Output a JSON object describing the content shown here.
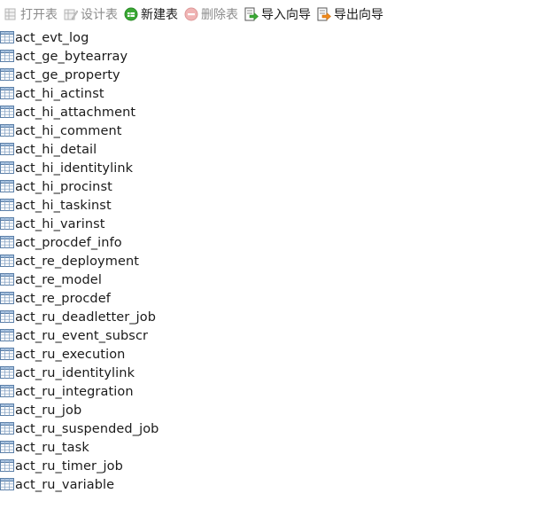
{
  "toolbar": {
    "open_table": {
      "label": "打开表",
      "icon": "open-table-icon",
      "enabled": false
    },
    "design_table": {
      "label": "设计表",
      "icon": "design-table-icon",
      "enabled": false
    },
    "new_table": {
      "label": "新建表",
      "icon": "new-table-icon",
      "enabled": true
    },
    "delete_table": {
      "label": "删除表",
      "icon": "delete-table-icon",
      "enabled": false
    },
    "import_wizard": {
      "label": "导入向导",
      "icon": "import-wizard-icon",
      "enabled": true
    },
    "export_wizard": {
      "label": "导出向导",
      "icon": "export-wizard-icon",
      "enabled": true
    }
  },
  "colors": {
    "disabled_text": "#8c8c8c",
    "new_table_green": "#3ba935",
    "delete_red": "#e25555",
    "wizard_orange": "#f08a1c",
    "table_icon_blue": "#3a6ea5"
  },
  "tables": [
    "act_evt_log",
    "act_ge_bytearray",
    "act_ge_property",
    "act_hi_actinst",
    "act_hi_attachment",
    "act_hi_comment",
    "act_hi_detail",
    "act_hi_identitylink",
    "act_hi_procinst",
    "act_hi_taskinst",
    "act_hi_varinst",
    "act_procdef_info",
    "act_re_deployment",
    "act_re_model",
    "act_re_procdef",
    "act_ru_deadletter_job",
    "act_ru_event_subscr",
    "act_ru_execution",
    "act_ru_identitylink",
    "act_ru_integration",
    "act_ru_job",
    "act_ru_suspended_job",
    "act_ru_task",
    "act_ru_timer_job",
    "act_ru_variable"
  ]
}
